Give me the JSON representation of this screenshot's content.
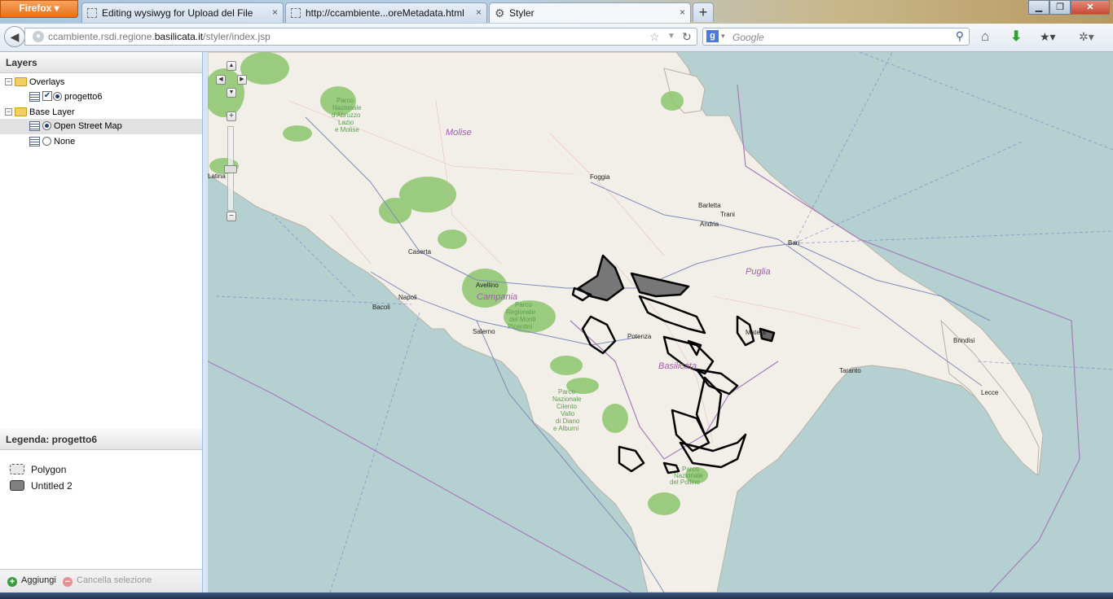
{
  "browser": {
    "menu_button": "Firefox",
    "tabs": [
      {
        "label": "Editing wysiwyg for Upload del File",
        "active": false
      },
      {
        "label": "http://ccambiente...oreMetadata.html",
        "active": false
      },
      {
        "label": "Styler",
        "active": true
      }
    ],
    "url_prefix": "ccambiente.rsdi.regione.",
    "url_domain": "basilicata.it",
    "url_path": "/styler/index.jsp",
    "search_placeholder": "Google",
    "new_tab": "+",
    "close_glyph": "×"
  },
  "layers_panel": {
    "title": "Layers",
    "nodes": [
      {
        "label": "Overlays"
      },
      {
        "label": "progetto6"
      },
      {
        "label": "Base Layer"
      },
      {
        "label": "Open Street Map"
      },
      {
        "label": "None"
      }
    ]
  },
  "legend_panel": {
    "title": "Legenda: progetto6",
    "rules": [
      {
        "label": "Polygon",
        "fill": "#e8e8e8",
        "stroke": "#555555"
      },
      {
        "label": "Untitled 2",
        "fill": "#808080",
        "stroke": "#333333"
      }
    ],
    "add_label": "Aggiungi",
    "remove_label": "Cancella selezione"
  },
  "map": {
    "regions": [
      "Molise",
      "Campania",
      "Puglia",
      "Basilicata"
    ],
    "cities": [
      "Foggia",
      "Barletta",
      "Trani",
      "Andria",
      "Bari",
      "Caserta",
      "Avellino",
      "Napoli",
      "Bacoli",
      "Salerno",
      "Potenza",
      "Matera",
      "Brindisi",
      "Taranto",
      "Lecce",
      "Latina"
    ],
    "parks": [
      [
        "Parco",
        "Nazionale",
        "d'Abruzzo",
        "Lazio",
        "e Molise"
      ],
      [
        "Parco",
        "Regionale",
        "dei Monti",
        "Picentini"
      ],
      [
        "Parco",
        "Nazionale",
        "Cilento",
        "Vallo",
        "di Diano",
        "e Alburni"
      ],
      [
        "Parco",
        "Nazionale",
        "del Pollino"
      ]
    ],
    "colors": {
      "sea": "#b5d0d0",
      "land": "#f2efe9",
      "forest": "#8dc56c",
      "overlay": "#000000"
    }
  }
}
